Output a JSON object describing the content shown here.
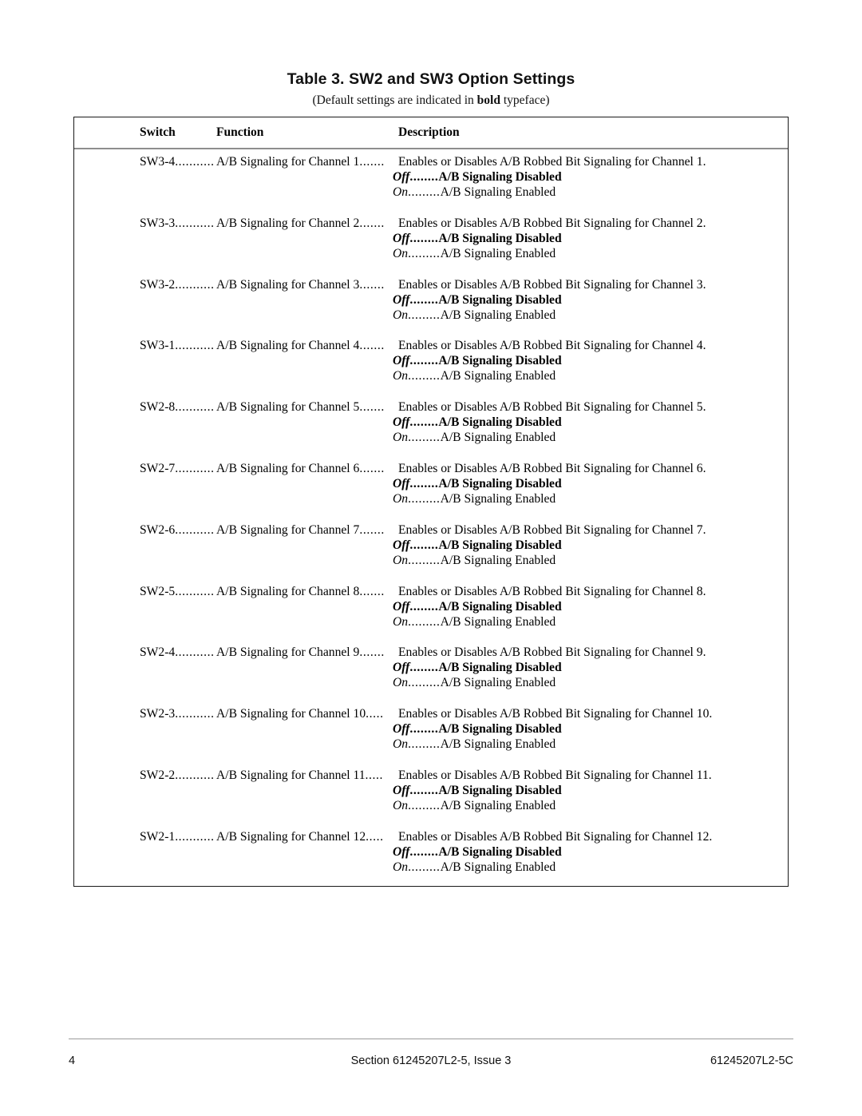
{
  "document": {
    "table_title": "Table 3.  SW2 and SW3 Option Settings",
    "subtitle_prefix": "(Default settings are indicated in ",
    "subtitle_bold": "bold",
    "subtitle_suffix": " typeface)"
  },
  "table": {
    "headers": {
      "switch": "Switch",
      "function": "Function",
      "description": "Description"
    },
    "rows": [
      {
        "switch": "SW3-4",
        "switch_leader": "...........",
        "function": "A/B Signaling for Channel 1",
        "function_leader": ".......",
        "description": "Enables or Disables A/B Robbed Bit Signaling for Channel 1.",
        "off_label": "Off",
        "off_leader": "........",
        "off_text": "A/B Signaling Disabled",
        "on_label": "On",
        "on_leader": ".........",
        "on_text": "A/B Signaling Enabled"
      },
      {
        "switch": "SW3-3",
        "switch_leader": "...........",
        "function": "A/B Signaling for Channel 2",
        "function_leader": ".......",
        "description": "Enables or Disables A/B Robbed Bit Signaling for Channel 2.",
        "off_label": "Off",
        "off_leader": "........",
        "off_text": "A/B Signaling Disabled",
        "on_label": "On",
        "on_leader": ".........",
        "on_text": "A/B Signaling Enabled"
      },
      {
        "switch": "SW3-2",
        "switch_leader": "...........",
        "function": "A/B Signaling for Channel 3",
        "function_leader": ".......",
        "description": "Enables or Disables A/B Robbed Bit Signaling for Channel 3.",
        "off_label": "Off",
        "off_leader": "........",
        "off_text": "A/B Signaling Disabled",
        "on_label": "On",
        "on_leader": ".........",
        "on_text": "A/B Signaling Enabled"
      },
      {
        "switch": "SW3-1",
        "switch_leader": "...........",
        "function": "A/B Signaling for Channel 4",
        "function_leader": ".......",
        "description": "Enables or Disables A/B Robbed Bit Signaling for Channel 4.",
        "off_label": "Off",
        "off_leader": "........",
        "off_text": "A/B Signaling Disabled",
        "on_label": "On",
        "on_leader": ".........",
        "on_text": "A/B Signaling Enabled"
      },
      {
        "switch": "SW2-8",
        "switch_leader": "...........",
        "function": "A/B Signaling for Channel 5",
        "function_leader": ".......",
        "description": "Enables or Disables A/B Robbed Bit Signaling for Channel 5.",
        "off_label": "Off",
        "off_leader": "........",
        "off_text": "A/B Signaling Disabled",
        "on_label": "On",
        "on_leader": ".........",
        "on_text": "A/B Signaling Enabled"
      },
      {
        "switch": "SW2-7",
        "switch_leader": "...........",
        "function": "A/B Signaling for Channel 6",
        "function_leader": ".......",
        "description": "Enables or Disables A/B Robbed Bit Signaling for Channel 6.",
        "off_label": "Off",
        "off_leader": "........",
        "off_text": "A/B Signaling Disabled",
        "on_label": "On",
        "on_leader": ".........",
        "on_text": "A/B Signaling Enabled"
      },
      {
        "switch": "SW2-6",
        "switch_leader": "...........",
        "function": "A/B Signaling for Channel 7",
        "function_leader": ".......",
        "description": "Enables or Disables A/B Robbed Bit Signaling for Channel 7.",
        "off_label": "Off",
        "off_leader": "........",
        "off_text": "A/B Signaling Disabled",
        "on_label": "On",
        "on_leader": ".........",
        "on_text": "A/B Signaling Enabled"
      },
      {
        "switch": "SW2-5",
        "switch_leader": "...........",
        "function": "A/B Signaling for Channel 8",
        "function_leader": ".......",
        "description": "Enables or Disables A/B Robbed Bit Signaling for Channel 8.",
        "off_label": "Off",
        "off_leader": "........",
        "off_text": "A/B Signaling Disabled",
        "on_label": "On",
        "on_leader": ".........",
        "on_text": "A/B Signaling Enabled"
      },
      {
        "switch": "SW2-4",
        "switch_leader": "...........",
        "function": "A/B Signaling for Channel 9",
        "function_leader": ".......",
        "description": "Enables or Disables A/B Robbed Bit Signaling for Channel 9.",
        "off_label": "Off",
        "off_leader": "........",
        "off_text": "A/B Signaling Disabled",
        "on_label": "On",
        "on_leader": ".........",
        "on_text": "A/B Signaling Enabled"
      },
      {
        "switch": "SW2-3",
        "switch_leader": "...........",
        "function": "A/B Signaling for Channel 10",
        "function_leader": ".....",
        "description": "Enables or Disables A/B Robbed Bit Signaling for Channel 10.",
        "off_label": "Off",
        "off_leader": "........",
        "off_text": "A/B Signaling Disabled",
        "on_label": "On",
        "on_leader": ".........",
        "on_text": "A/B Signaling Enabled"
      },
      {
        "switch": "SW2-2",
        "switch_leader": "...........",
        "function": "A/B Signaling for Channel 11",
        "function_leader": ".....",
        "description": "Enables or Disables A/B Robbed Bit Signaling for Channel 11.",
        "off_label": "Off",
        "off_leader": "........",
        "off_text": "A/B Signaling Disabled",
        "on_label": "On",
        "on_leader": ".........",
        "on_text": "A/B Signaling Enabled"
      },
      {
        "switch": "SW2-1",
        "switch_leader": "...........",
        "function": "A/B Signaling for Channel 12",
        "function_leader": ".....",
        "description": "Enables or Disables A/B Robbed Bit Signaling for Channel 12.",
        "off_label": "Off",
        "off_leader": "........",
        "off_text": "A/B Signaling Disabled",
        "on_label": "On",
        "on_leader": ".........",
        "on_text": "A/B Signaling Enabled"
      }
    ]
  },
  "footer": {
    "page_number": "4",
    "section": "Section 61245207L2-5, Issue 3",
    "document_id": "61245207L2-5C"
  }
}
